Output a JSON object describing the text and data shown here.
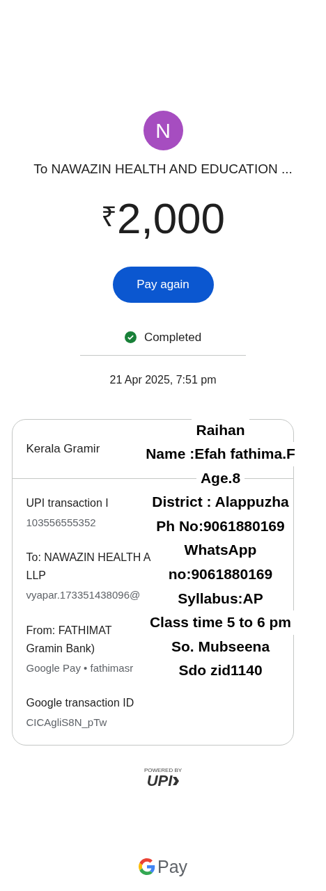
{
  "payee": {
    "initial": "N",
    "title": "To NAWAZIN HEALTH AND EDUCATION ..."
  },
  "amount": {
    "currency": "₹",
    "value": "2,000"
  },
  "pay_again_button": "Pay again",
  "status": {
    "label": "Completed",
    "completed": true
  },
  "date": "21 Apr 2025, 7:51 pm",
  "card": {
    "header": "Kerala Gramir",
    "rows": [
      {
        "label": "UPI transaction I",
        "value": "103556555352"
      },
      {
        "label": "To: NAWAZIN HEALTH A",
        "label_2": "LLP",
        "value": "vyapar.17335143809​6@"
      },
      {
        "label": "From: FATHIMAT",
        "label_2": "Gramin Bank)",
        "value": "Google Pay • fathimasr"
      },
      {
        "label": "Google transaction ID",
        "value": "CICAgliS8N_pTw"
      }
    ]
  },
  "overlay_note": [
    "Raihan",
    "Name :Efah fathima.F",
    "Age.8",
    "District : Alappuzha",
    "Ph No:9061880169",
    "WhatsApp",
    "no:9061880169",
    "Syllabus:AP",
    "Class time 5 to 6 pm",
    "So. Mubseena",
    "Sdo zid1140"
  ],
  "upi_badge": {
    "caption": "POWERED BY",
    "logo_text": "UPI"
  },
  "footer_brand": "Pay"
}
